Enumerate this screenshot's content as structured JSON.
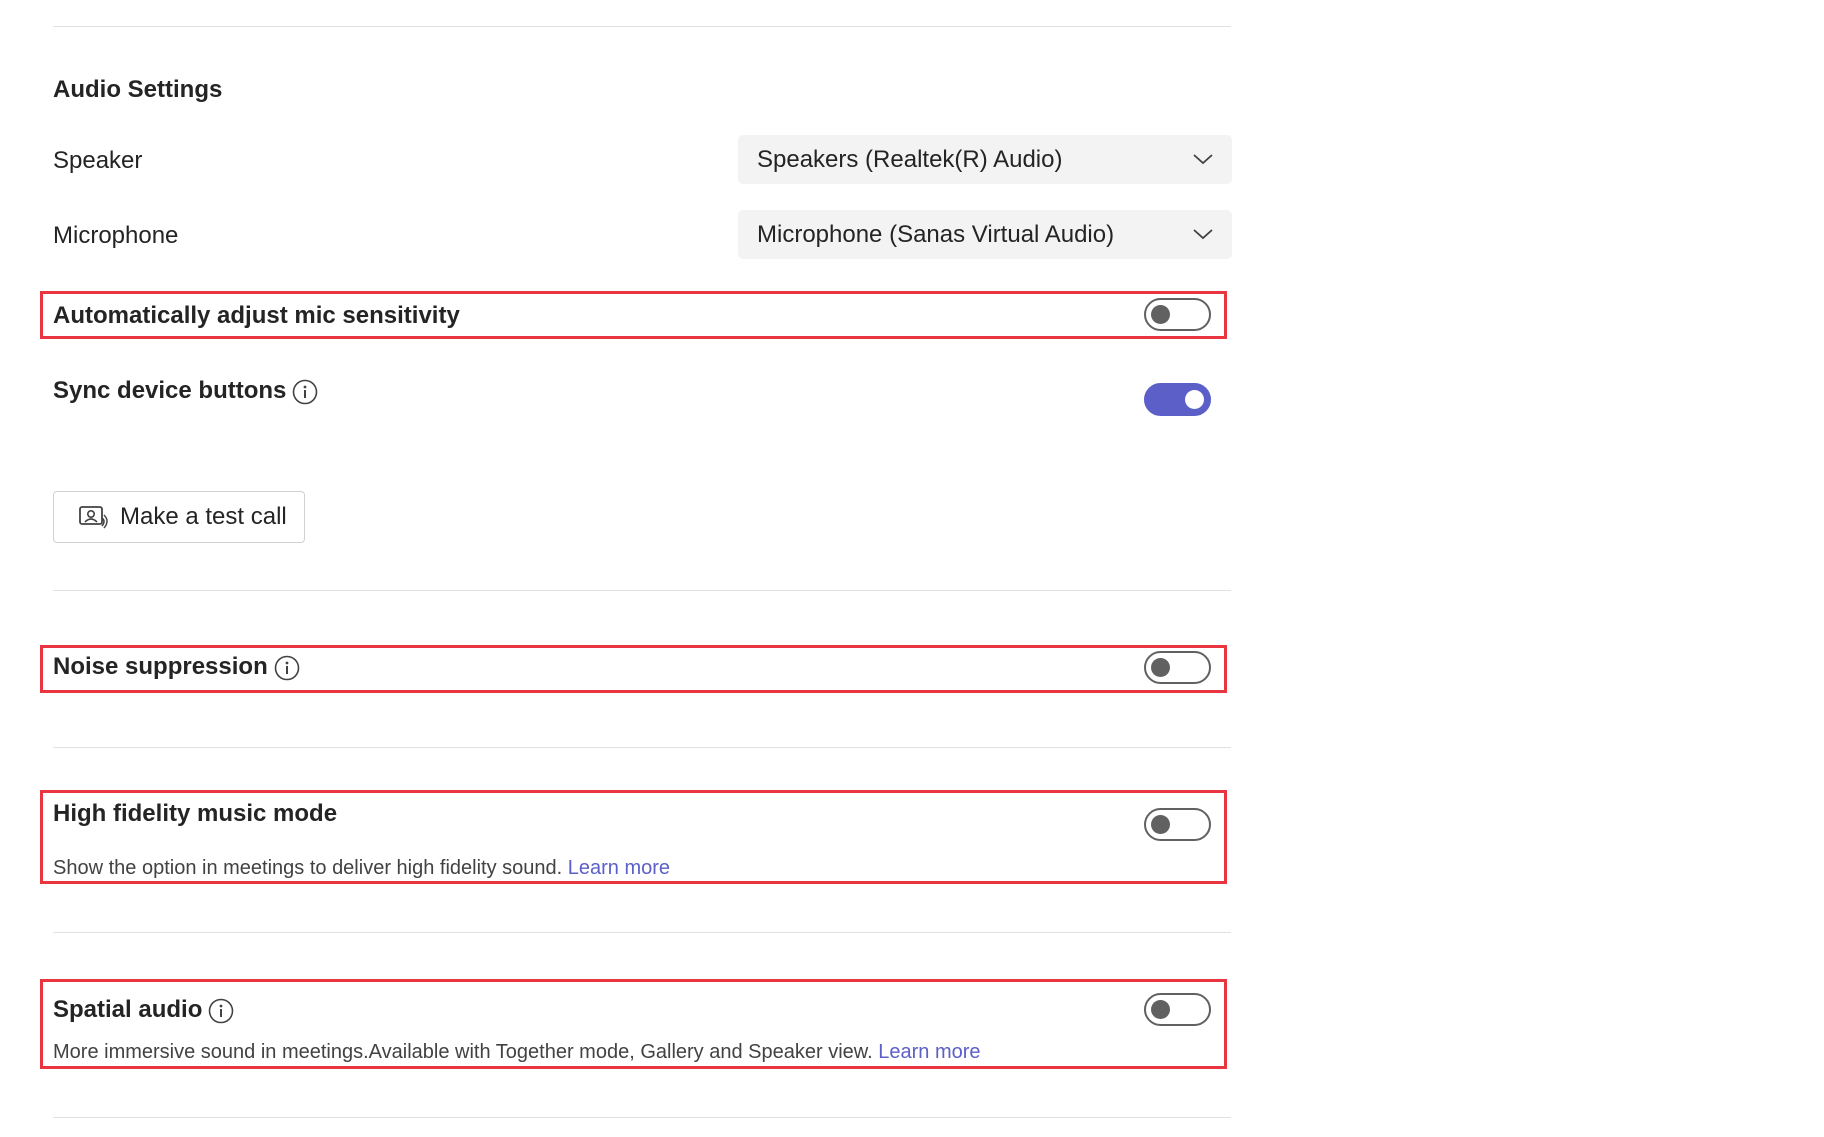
{
  "section_title": "Audio Settings",
  "speaker": {
    "label": "Speaker",
    "value": "Speakers (Realtek(R) Audio)"
  },
  "microphone": {
    "label": "Microphone",
    "value": "Microphone (Sanas Virtual Audio)"
  },
  "auto_adjust": {
    "label": "Automatically adjust mic sensitivity",
    "enabled": false
  },
  "sync_buttons": {
    "label": "Sync device buttons",
    "enabled": true
  },
  "test_call": {
    "label": "Make a test call"
  },
  "noise_suppression": {
    "label": "Noise suppression",
    "enabled": false
  },
  "hifi_music": {
    "label": "High fidelity music mode",
    "description": "Show the option in meetings to deliver high fidelity sound.",
    "link": "Learn more",
    "enabled": false
  },
  "spatial_audio": {
    "label": "Spatial audio",
    "description": "More immersive sound in meetings.Available with Together mode, Gallery and Speaker view.",
    "link": "Learn more",
    "enabled": false
  },
  "colors": {
    "accent": "#5b5fc7",
    "highlight": "#e8353f",
    "toggle_off": "#616161"
  }
}
